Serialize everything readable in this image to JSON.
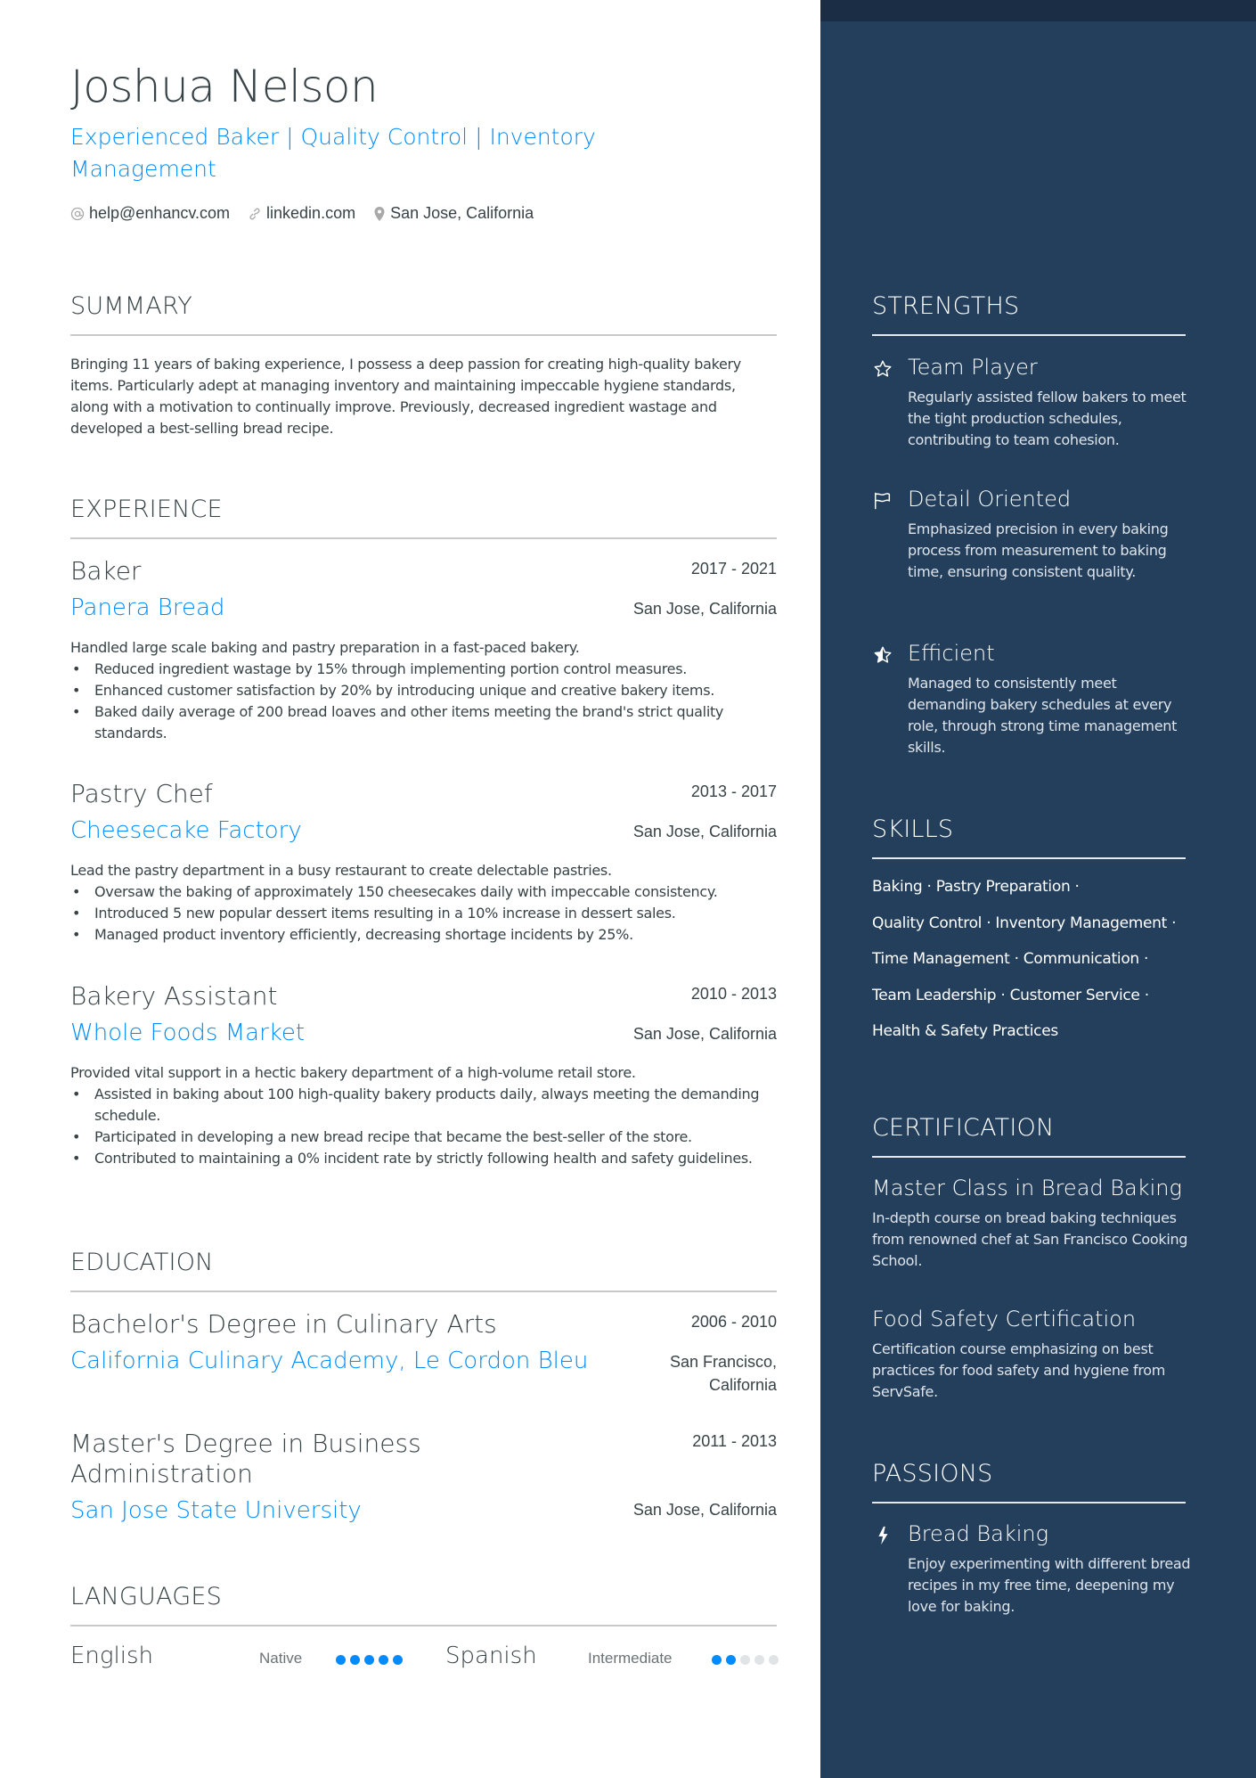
{
  "header": {
    "name": "Joshua Nelson",
    "headline": "Experienced Baker | Quality Control | Inventory Management",
    "contacts": [
      {
        "icon": "at-icon",
        "text": "help@enhancv.com"
      },
      {
        "icon": "link-icon",
        "text": "linkedin.com"
      },
      {
        "icon": "location-pin-icon",
        "text": "San Jose, California"
      }
    ]
  },
  "summary": {
    "title": "SUMMARY",
    "text": "Bringing 11 years of baking experience, I possess a deep passion for creating high-quality bakery items. Particularly adept at managing inventory and maintaining impeccable hygiene standards, along with a motivation to continually improve. Previously, decreased ingredient wastage and developed a best-selling bread recipe."
  },
  "experience": {
    "title": "EXPERIENCE",
    "items": [
      {
        "role": "Baker",
        "dates": "2017 - 2021",
        "company": "Panera Bread",
        "location": "San Jose, California",
        "description": "Handled large scale baking and pastry preparation in a fast-paced bakery.",
        "bullets": [
          "Reduced ingredient wastage by 15% through implementing portion control measures.",
          "Enhanced customer satisfaction by 20% by introducing unique and creative bakery items.",
          "Baked daily average of 200 bread loaves and other items meeting the brand's strict quality standards."
        ]
      },
      {
        "role": "Pastry Chef",
        "dates": "2013 - 2017",
        "company": "Cheesecake Factory",
        "location": "San Jose, California",
        "description": "Lead the pastry department in a busy restaurant to create delectable pastries.",
        "bullets": [
          "Oversaw the baking of approximately 150 cheesecakes daily with impeccable consistency.",
          "Introduced 5 new popular dessert items resulting in a 10% increase in dessert sales.",
          "Managed product inventory efficiently, decreasing shortage incidents by 25%."
        ]
      },
      {
        "role": "Bakery Assistant",
        "dates": "2010 - 2013",
        "company": "Whole Foods Market",
        "location": "San Jose, California",
        "description": "Provided vital support in a hectic bakery department of a high-volume retail store.",
        "bullets": [
          "Assisted in baking about 100 high-quality bakery products daily, always meeting the demanding schedule.",
          "Participated in developing a new bread recipe that became the best-seller of the store.",
          "Contributed to maintaining a 0% incident rate by strictly following health and safety guidelines."
        ]
      }
    ]
  },
  "education": {
    "title": "EDUCATION",
    "items": [
      {
        "degree": "Bachelor's Degree in Culinary Arts",
        "dates": "2006 - 2010",
        "school": "California Culinary Academy, Le Cordon Bleu",
        "location_line1": "San Francisco,",
        "location_line2": "California"
      },
      {
        "degree_line1": "Master's Degree in Business",
        "degree_line2": "Administration",
        "dates": "2011 - 2013",
        "school": "San Jose State University",
        "location": "San Jose, California"
      }
    ]
  },
  "languages": {
    "title": "LANGUAGES",
    "items": [
      {
        "name": "English",
        "level": "Native",
        "rating": 5,
        "max": 5
      },
      {
        "name": "Spanish",
        "level": "Intermediate",
        "rating": 2,
        "max": 5
      }
    ]
  },
  "strengths": {
    "title": "STRENGTHS",
    "items": [
      {
        "icon": "star-outline-icon",
        "title": "Team Player",
        "description": "Regularly assisted fellow bakers to meet the tight production schedules, contributing to team cohesion."
      },
      {
        "icon": "flag-icon",
        "title": "Detail Oriented",
        "description": "Emphasized precision in every baking process from measurement to baking time, ensuring consistent quality."
      },
      {
        "icon": "star-half-icon",
        "title": "Efficient",
        "description": "Managed to consistently meet demanding bakery schedules at every role, through strong time management skills."
      }
    ]
  },
  "skills": {
    "title": "SKILLS",
    "lines": [
      "Baking · Pastry Preparation ·",
      "Quality Control · Inventory Management ·",
      "Time Management · Communication ·",
      "Team Leadership · Customer Service ·",
      "Health & Safety Practices"
    ]
  },
  "certification": {
    "title": "CERTIFICATION",
    "items": [
      {
        "title": "Master Class in Bread Baking",
        "description": "In-depth course on bread baking techniques from renowned chef at San Francisco Cooking School."
      },
      {
        "title": "Food Safety Certification",
        "description": "Certification course emphasizing on best practices for food safety and hygiene from ServSafe."
      }
    ]
  },
  "passions": {
    "title": "PASSIONS",
    "items": [
      {
        "icon": "lightning-bolt-icon",
        "title": "Bread Baking",
        "description": "Enjoy experimenting with different bread recipes in my free time, deepening my love for baking."
      }
    ]
  },
  "colors": {
    "accent": "#008cff",
    "sidebar_bg": "#233f5c",
    "sidebar_topbar": "#1a2d44",
    "text": "#384347"
  }
}
